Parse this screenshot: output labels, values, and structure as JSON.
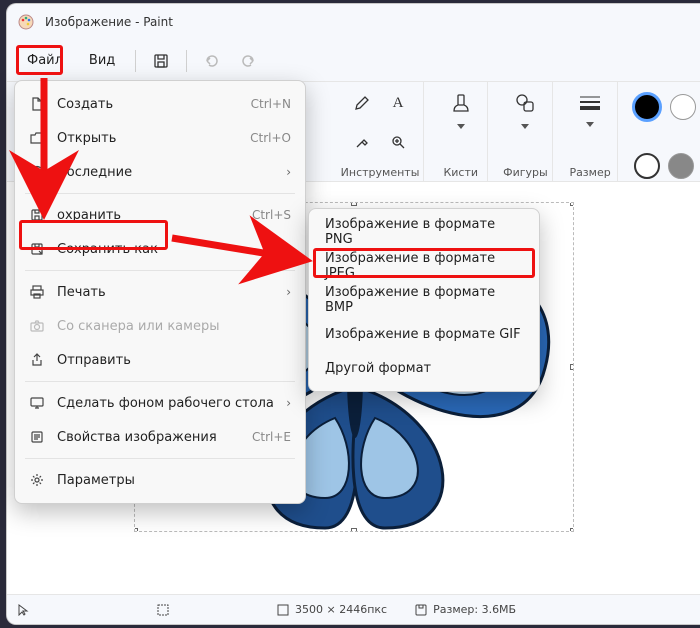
{
  "title": "Изображение - Paint",
  "menubar": {
    "file": "Файл",
    "view": "Вид"
  },
  "ribbon": {
    "tools": "Инструменты",
    "brushes": "Кисти",
    "shapes": "Фигуры",
    "size": "Размер"
  },
  "file_menu": {
    "new": {
      "label": "Создать",
      "shortcut": "Ctrl+N"
    },
    "open": {
      "label": "Открыть",
      "shortcut": "Ctrl+O"
    },
    "recent": {
      "label": "Последние"
    },
    "save": {
      "label": "охранить",
      "shortcut": "Ctrl+S"
    },
    "save_as": {
      "label": "Сохранить как"
    },
    "print": {
      "label": "Печать"
    },
    "scanner": {
      "label": "Со сканера или камеры"
    },
    "send": {
      "label": "Отправить"
    },
    "wallpaper": {
      "label": "Сделать фоном рабочего стола"
    },
    "properties": {
      "label": "Свойства изображения",
      "shortcut": "Ctrl+E"
    },
    "settings": {
      "label": "Параметры"
    }
  },
  "save_as_menu": {
    "png": "Изображение в формате PNG",
    "jpeg": "Изображение в формате JPEG",
    "bmp": "Изображение в формате BMP",
    "gif": "Изображение в формате GIF",
    "other": "Другой формат"
  },
  "statusbar": {
    "dimensions": "3500 × 2446пкс",
    "size": "Размер: 3.6МБ"
  },
  "colors": {
    "fg": "#000000",
    "bg": "#ffffff"
  }
}
